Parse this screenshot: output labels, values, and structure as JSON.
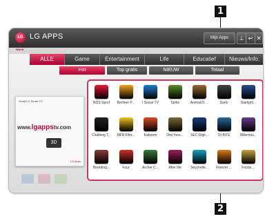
{
  "callouts": [
    "1",
    "2"
  ],
  "window": {
    "logo_text": "LG",
    "title": "LG APPS",
    "sublabel": "World",
    "mijn_apps": "Mijn Apps",
    "controls": [
      "⊥",
      "↩",
      "✕"
    ]
  },
  "categories": [
    "ALLE",
    "Game",
    "Entertainment",
    "Life",
    "Educatief",
    "Nieuws/Info."
  ],
  "subtabs": [
    "Hot",
    "Top gratis",
    "NIEUW",
    "Totaal"
  ],
  "promo": {
    "header": "Great LG Smart TV",
    "url_prefix": "www.",
    "url_brand": "lgapps",
    "url_suffix": "tv.com",
    "badge": "3D",
    "footer": "LG Apps"
  },
  "apps": [
    {
      "label": "NOS Sport",
      "color": "#e8173a"
    },
    {
      "label": "Berliner P...",
      "color": "#f2a21a"
    },
    {
      "label": "i Social TV",
      "color": "#1f7bd1"
    },
    {
      "label": "Tanks",
      "color": "#5a8c2a"
    },
    {
      "label": "Animal21 ...",
      "color": "#9c6a3a"
    },
    {
      "label": "Darts",
      "color": "#444444"
    },
    {
      "label": "Starlight...",
      "color": "#2a4f9c"
    },
    {
      "label": "Clubbing T...",
      "color": "#222222"
    },
    {
      "label": "MFB Film...",
      "color": "#f3c21f"
    },
    {
      "label": "Kaboom",
      "color": "#d94b2a"
    },
    {
      "label": "Om/ foes...",
      "color": "#7a6a3a"
    },
    {
      "label": "SEC Digit...",
      "color": "#1a3d7a"
    },
    {
      "label": "Tri BITE",
      "color": "#2a6a9c"
    },
    {
      "label": "Millenniu...",
      "color": "#6a3a8c"
    },
    {
      "label": "Breeding...",
      "color": "#8c3a3a"
    },
    {
      "label": "Four",
      "color": "#d1302a"
    },
    {
      "label": "Archer C...",
      "color": "#3a7a3a"
    },
    {
      "label": "After life",
      "color": "#a0205a"
    },
    {
      "label": "Seychelle...",
      "color": "#1aa0c0"
    },
    {
      "label": "Freezer ...",
      "color": "#e07a1a"
    },
    {
      "label": "Foods ...",
      "color": "#c8a040"
    }
  ]
}
